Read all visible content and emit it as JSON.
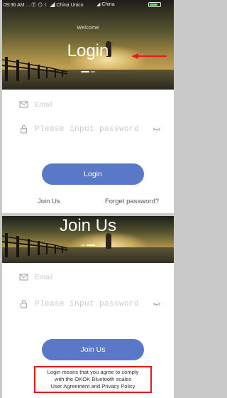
{
  "login_screen": {
    "status_bar": {
      "left": "09:36 AM ... Ⓣ ⊙ ☾ ◢ China Unico",
      "carrier": "◢ China",
      "battery_level": 0.8
    },
    "welcome": "Welcome",
    "title": "Login",
    "email_placeholder": "Email",
    "password_placeholder": "Please input password",
    "login_button": "Login",
    "join_link": "Join Us",
    "forget_link": "Forget password?"
  },
  "join_screen": {
    "title": "Join Us",
    "email_placeholder": "Email",
    "password_placeholder": "Please input password",
    "join_button": "Join Us",
    "agreement": {
      "line1": "Login means that you agree to comply",
      "line2": "with the OKOK Bluetooth scales",
      "line3": "User Agreement and Privacy Policy"
    }
  },
  "icons": {
    "email": "mail-icon",
    "password": "lock-icon",
    "visibility": "eye-closed-icon",
    "annotation": "red-arrow-icon"
  },
  "colors": {
    "accent": "#5a78c8",
    "annotation": "#e61a1a",
    "placeholder": "#c5cad6"
  }
}
